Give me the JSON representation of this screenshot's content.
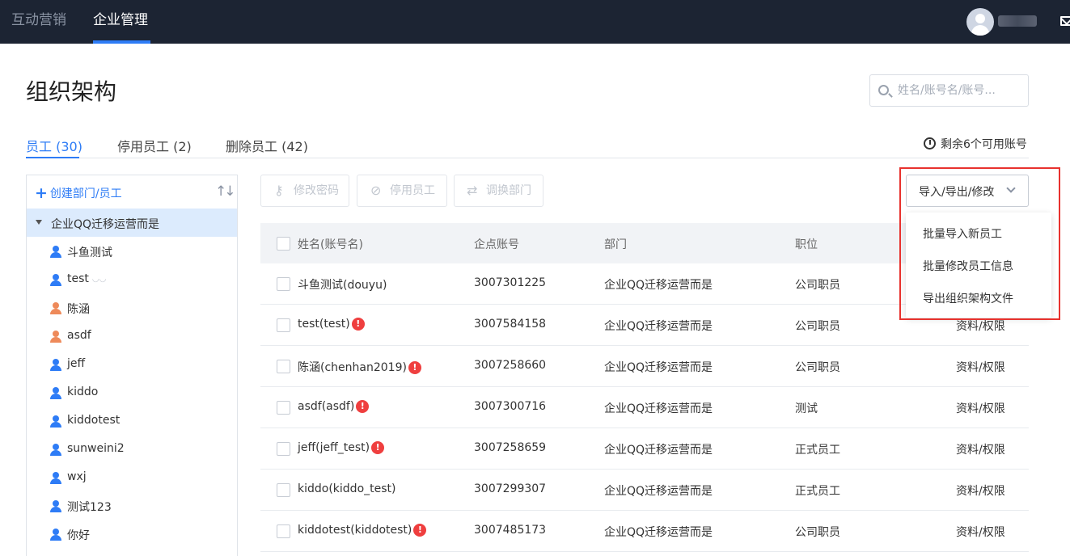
{
  "nav": {
    "items": [
      {
        "label": "互动营销"
      },
      {
        "label": "企业管理"
      }
    ]
  },
  "page": {
    "title": "组织架构"
  },
  "search": {
    "placeholder": "姓名/账号名/账号..."
  },
  "tabs": [
    {
      "label": "员工 (30)"
    },
    {
      "label": "停用员工 (2)"
    },
    {
      "label": "删除员工 (42)"
    }
  ],
  "quota": {
    "text": "剩余6个可用账号"
  },
  "tree": {
    "create_label": "创建部门/员工",
    "sort_glyph": "↑↓",
    "root": "企业QQ迁移运营而是",
    "members": [
      {
        "name": "斗鱼测试",
        "color": "blue"
      },
      {
        "name": "test",
        "color": "blue"
      },
      {
        "name": "陈涵",
        "color": "orange"
      },
      {
        "name": "asdf",
        "color": "orange"
      },
      {
        "name": "jeff",
        "color": "blue"
      },
      {
        "name": "kiddo",
        "color": "blue"
      },
      {
        "name": "kiddotest",
        "color": "blue"
      },
      {
        "name": "sunweini2",
        "color": "blue"
      },
      {
        "name": "wxj",
        "color": "blue"
      },
      {
        "name": "测试123",
        "color": "blue"
      },
      {
        "name": "你好",
        "color": "blue"
      }
    ]
  },
  "toolbar": {
    "change_password": "修改密码",
    "disable_employee": "停用员工",
    "transfer_dept": "调换部门",
    "import_export": "导入/导出/修改"
  },
  "menu": {
    "items": [
      "批量导入新员工",
      "批量修改员工信息",
      "导出组织架构文件"
    ]
  },
  "table": {
    "headers": [
      "姓名(账号名)",
      "企点账号",
      "部门",
      "职位"
    ],
    "rows": [
      {
        "name": "斗鱼测试(douyu)",
        "warn": false,
        "account": "3007301225",
        "dept": "企业QQ迁移运营而是",
        "title": "公司职员",
        "action": ""
      },
      {
        "name": "test(test)",
        "warn": true,
        "account": "3007584158",
        "dept": "企业QQ迁移运营而是",
        "title": "公司职员",
        "action": "资料/权限"
      },
      {
        "name": "陈涵(chenhan2019)",
        "warn": true,
        "account": "3007258660",
        "dept": "企业QQ迁移运营而是",
        "title": "公司职员",
        "action": "资料/权限"
      },
      {
        "name": "asdf(asdf)",
        "warn": true,
        "account": "3007300716",
        "dept": "企业QQ迁移运营而是",
        "title": "测试",
        "action": "资料/权限"
      },
      {
        "name": "jeff(jeff_test)",
        "warn": true,
        "account": "3007258659",
        "dept": "企业QQ迁移运营而是",
        "title": "正式员工",
        "action": "资料/权限"
      },
      {
        "name": "kiddo(kiddo_test)",
        "warn": false,
        "account": "3007299307",
        "dept": "企业QQ迁移运营而是",
        "title": "正式员工",
        "action": "资料/权限"
      },
      {
        "name": "kiddotest(kiddotest)",
        "warn": true,
        "account": "3007485173",
        "dept": "企业QQ迁移运营而是",
        "title": "公司职员",
        "action": "资料/权限"
      }
    ]
  },
  "colors": {
    "nav_bg": "#1c2433",
    "accent": "#2e7cf6",
    "warning": "#ef3f3f",
    "highlight": "#e8322e"
  }
}
